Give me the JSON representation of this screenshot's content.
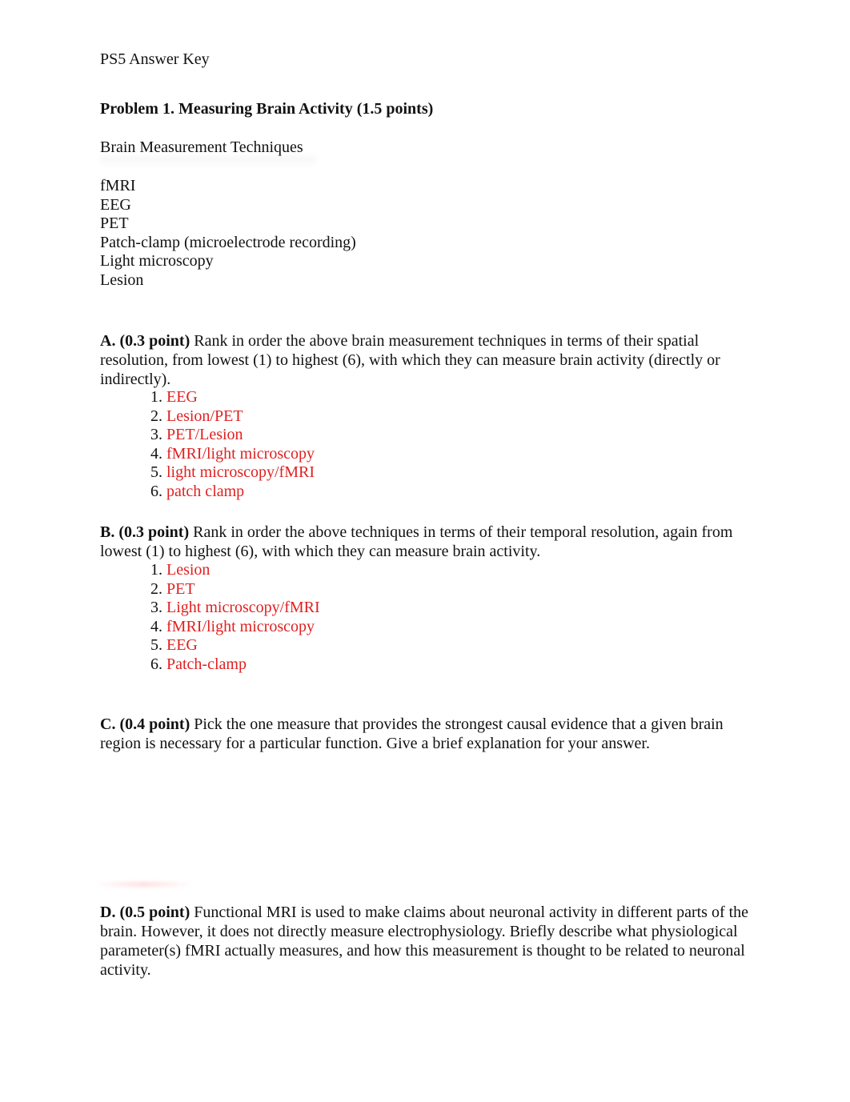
{
  "document": {
    "header": "PS5 Answer Key",
    "problem_title": "Problem 1.  Measuring Brain Activity  (1.5 points)",
    "techniques_heading": "Brain Measurement Techniques",
    "techniques": [
      "fMRI",
      "EEG",
      "PET",
      "Patch-clamp (microelectrode recording)",
      "Light microscopy",
      "Lesion"
    ],
    "questions": {
      "A": {
        "label": "A.  (0.3 point)",
        "text": " Rank in order the above brain measurement techniques in terms of their spatial resolution, from lowest (1) to highest (6), with which they can measure brain activity (directly or indirectly).",
        "answers": [
          {
            "num": "1.",
            "text": "EEG"
          },
          {
            "num": "2.",
            "text": "Lesion/PET"
          },
          {
            "num": "3.",
            "text": "PET/Lesion"
          },
          {
            "num": "4.",
            "text": "fMRI/light microscopy"
          },
          {
            "num": "5.",
            "text": "light microscopy/fMRI"
          },
          {
            "num": "6.",
            "text": "patch clamp"
          }
        ]
      },
      "B": {
        "label": "B.  (0.3 point)",
        "text": " Rank in order the above techniques in terms of their temporal resolution, again from lowest (1) to highest (6), with which they can measure brain activity.",
        "answers": [
          {
            "num": "1.",
            "text": "Lesion"
          },
          {
            "num": "2.",
            "text": "PET"
          },
          {
            "num": "3.",
            "text": "Light microscopy/fMRI"
          },
          {
            "num": "4.",
            "text": "fMRI/light microscopy"
          },
          {
            "num": "5.",
            "text": "EEG"
          },
          {
            "num": "6.",
            "text": "Patch-clamp"
          }
        ]
      },
      "C": {
        "label": "C.  (0.4 point)",
        "text": " Pick the one measure that provides the strongest causal evidence that a given brain region is necessary for a particular function. Give a brief explanation for your answer."
      },
      "D": {
        "label": "D.  (0.5 point)",
        "text": " Functional MRI is used to make claims about neuronal activity in different parts of the brain. However, it does not directly measure electrophysiology. Briefly describe what physiological parameter(s) fMRI actually measures, and how this measurement is thought to be related to neuronal activity."
      }
    },
    "colors": {
      "text": "#111111",
      "answer": "#e02020"
    }
  }
}
